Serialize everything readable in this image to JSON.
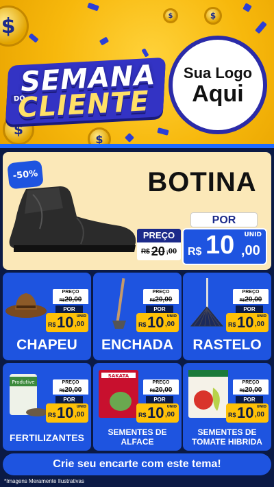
{
  "header": {
    "title_line1": "SEMANA",
    "title_connector": "DO",
    "title_line2": "CLIENTE",
    "logo_line1": "Sua Logo",
    "logo_line2": "Aqui"
  },
  "featured": {
    "discount": "-50%",
    "name": "BOTINA",
    "por_label": "POR",
    "preco_label": "PREÇO",
    "old_currency": "R$",
    "old_int": "20",
    "old_dec": ",00",
    "new_unit": "UNID",
    "new_currency": "R$",
    "new_int": "10",
    "new_dec": ",00",
    "image_icon": "boot-icon"
  },
  "products": [
    {
      "name": "CHAPEU",
      "icon": "hat-icon",
      "preco_label": "PREÇO",
      "old_currency": "R$",
      "old_price": "20,00",
      "por_label": "POR",
      "unit": "UNID",
      "currency": "R$",
      "new_int": "10",
      "new_dec": ",00"
    },
    {
      "name": "ENCHADA",
      "icon": "hoe-icon",
      "preco_label": "PREÇO",
      "old_currency": "R$",
      "old_price": "20,00",
      "por_label": "POR",
      "unit": "UNID",
      "currency": "R$",
      "new_int": "10",
      "new_dec": ",00"
    },
    {
      "name": "RASTELO",
      "icon": "rake-icon",
      "preco_label": "PREÇO",
      "old_currency": "R$",
      "old_price": "20,00",
      "por_label": "POR",
      "unit": "UNID",
      "currency": "R$",
      "new_int": "10",
      "new_dec": ",00"
    },
    {
      "name": "FERTILIZANTES",
      "icon": "fertilizer-bag-icon",
      "preco_label": "PREÇO",
      "old_currency": "R$",
      "old_price": "20,00",
      "por_label": "POR",
      "unit": "UNID",
      "currency": "R$",
      "new_int": "10",
      "new_dec": ",00"
    },
    {
      "name_l1": "SEMENTES DE",
      "name_l2": "ALFACE",
      "icon": "seed-packet-icon",
      "preco_label": "PREÇO",
      "old_currency": "R$",
      "old_price": "20,00",
      "por_label": "POR",
      "unit": "UNID",
      "currency": "R$",
      "new_int": "10",
      "new_dec": ",00"
    },
    {
      "name_l1": "SEMENTES DE",
      "name_l2": "TOMATE HIBRIDA",
      "icon": "tomato-seed-packet-icon",
      "preco_label": "PREÇO",
      "old_currency": "R$",
      "old_price": "20,00",
      "por_label": "POR",
      "unit": "UNID",
      "currency": "R$",
      "new_int": "10",
      "new_dec": ",00"
    }
  ],
  "products_extra_labels": {
    "fertilizer_bag_brand": "Produtive",
    "seed_packet_brand": "SAKATA"
  },
  "footer": {
    "cta": "Crie seu encarte com este tema!",
    "disclaimer": "*Imagens Meramente Ilustrativas"
  },
  "colors": {
    "background": "#0b1a45",
    "accent_blue": "#1e54e0",
    "header_yellow": "#f7b80c",
    "price_yellow": "#ffc107",
    "featured_bg": "#fbe8b8"
  }
}
